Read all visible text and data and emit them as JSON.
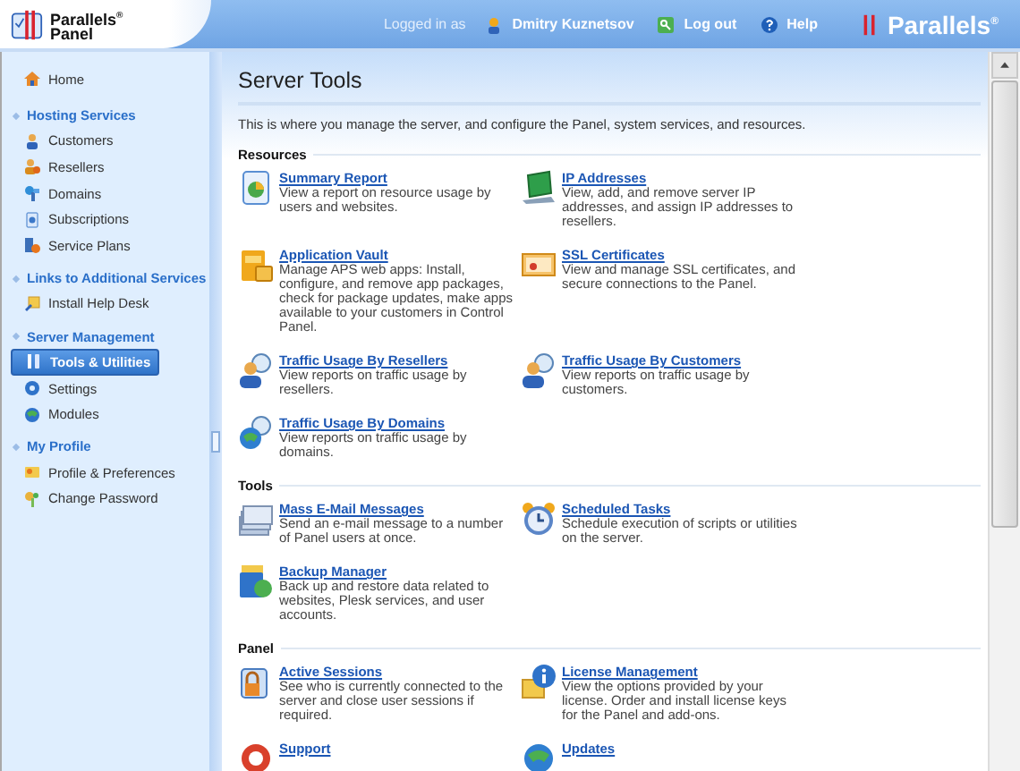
{
  "header": {
    "product_logo": "Parallels$^{®}$",
    "product_name": "Panel",
    "logged_in_label": "Logged in as",
    "user": "Dmitry Kuznetsov",
    "logout": "Log out",
    "help": "Help",
    "brand_logo": "Parallels$^{®}$"
  },
  "sidebar": {
    "home": {
      "label": "Home",
      "selected": false
    },
    "sections": [
      {
        "title": "Hosting Services",
        "items": [
          {
            "label": "Customers",
            "selected": false
          },
          {
            "label": "Resellers",
            "selected": false
          },
          {
            "label": "Domains",
            "selected": false
          },
          {
            "label": "Subscriptions",
            "selected": false
          },
          {
            "label": "Service Plans",
            "selected": false
          }
        ]
      },
      {
        "title": "Links to Additional Services",
        "items": [
          {
            "label": "Install Help Desk",
            "selected": false
          }
        ]
      },
      {
        "title": "Server Management",
        "items": [
          {
            "label": "Tools & Utilities",
            "selected": true
          },
          {
            "label": "Settings",
            "selected": false
          },
          {
            "label": "Modules",
            "selected": false
          }
        ]
      },
      {
        "title": "My Profile",
        "items": [
          {
            "label": "Profile & Preferences",
            "selected": false
          },
          {
            "label": "Change Password",
            "selected": false
          }
        ]
      }
    ]
  },
  "page": {
    "title": "Server Tools",
    "description": "This is where you manage the server, and configure the Panel, system services, and resources.",
    "sections": [
      {
        "title": "Resources",
        "items": [
          {
            "title": "Summary Report",
            "description": "View a report on resource usage by users and websites."
          },
          {
            "title": "IP Addresses",
            "description": "View, add, and remove server IP addresses, and assign IP addresses to resellers."
          },
          {
            "title": "Application Vault",
            "description": "Manage APS web apps: Install, configure, and remove app packages, check for package updates, make apps available to your customers in Control Panel."
          },
          {
            "title": "SSL Certificates",
            "description": "View and manage SSL certificates, and secure connections to the Panel."
          },
          {
            "title": "Traffic Usage By Resellers",
            "description": "View reports on traffic usage by resellers."
          },
          {
            "title": "Traffic Usage By Customers",
            "description": "View reports on traffic usage by customers."
          },
          {
            "title": "Traffic Usage By Domains",
            "description": "View reports on traffic usage by domains."
          }
        ]
      },
      {
        "title": "Tools",
        "items": [
          {
            "title": "Mass E-Mail Messages",
            "description": "Send an e-mail message to a number of Panel users at once."
          },
          {
            "title": "Scheduled Tasks",
            "description": "Schedule execution of scripts or utilities on the server."
          },
          {
            "title": "Backup Manager",
            "description": "Back up and restore data related to websites, Plesk services, and user accounts."
          }
        ]
      },
      {
        "title": "Panel",
        "items": [
          {
            "title": "Active Sessions",
            "description": "See who is currently connected to the server and close user sessions if required."
          },
          {
            "title": "License Management",
            "description": "View the options provided by your license. Order and install license keys for the Panel and add-ons."
          },
          {
            "title": "Support"
          },
          {
            "title": "Updates"
          }
        ]
      }
    ]
  }
}
